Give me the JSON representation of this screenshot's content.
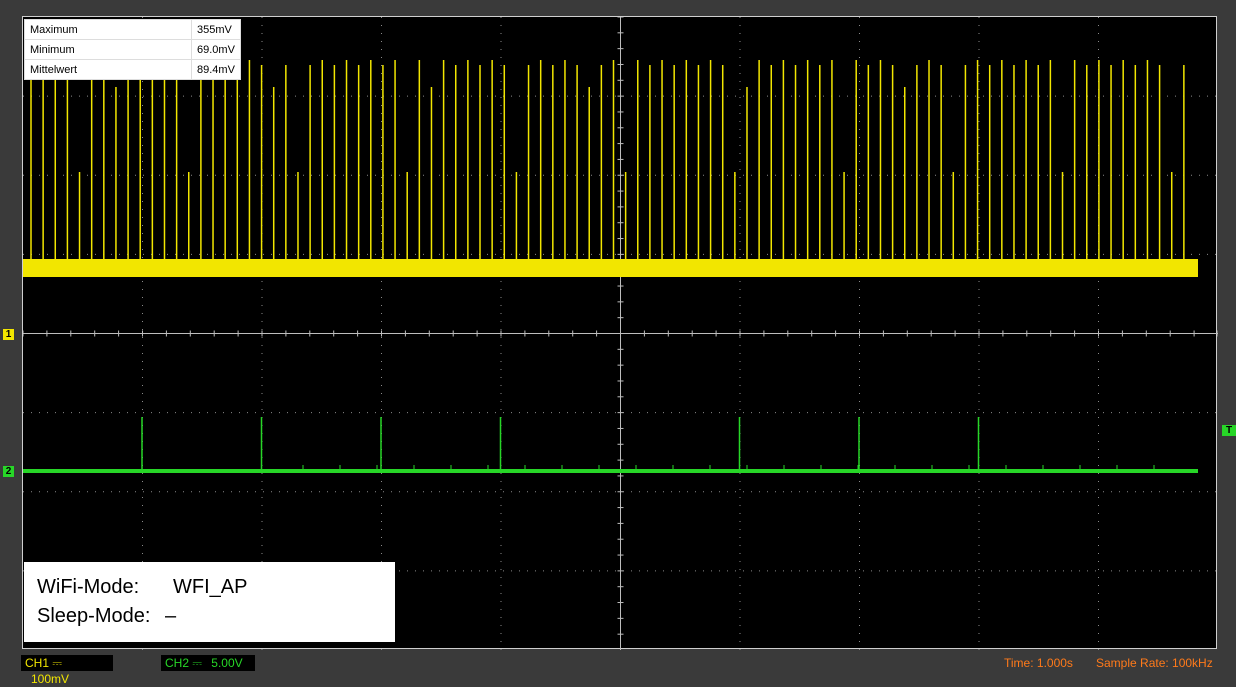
{
  "measurements": [
    {
      "label": "Maximum",
      "value": "355mV"
    },
    {
      "label": "Minimum",
      "value": "69.0mV"
    },
    {
      "label": "Mittelwert",
      "value": "89.4mV"
    }
  ],
  "info": {
    "wifi_label": "WiFi-Mode:",
    "wifi_value": "WFI_AP",
    "sleep_label": "Sleep-Mode:",
    "sleep_value": "–"
  },
  "markers": {
    "ch1": "1",
    "ch2": "2",
    "trigger": "T"
  },
  "status": {
    "ch1_label": "CH1",
    "ch1_coupling": "⎓",
    "ch1_scale": "100mV",
    "ch2_label": "CH2",
    "ch2_coupling": "⎓",
    "ch2_scale": "5.00V",
    "time": "Time: 1.000s",
    "sample_rate": "Sample Rate: 100kHz"
  },
  "colors": {
    "ch1": "#f2e600",
    "ch2": "#27d627",
    "status_text": "#ff7a1a",
    "grid": "#8a8a8a"
  },
  "chart_data": {
    "type": "line",
    "grid": {
      "divisions_x": 10,
      "divisions_y": 8
    },
    "series": [
      {
        "name": "CH1",
        "description_values": {
          "max_mV": 355,
          "min_mV": 69.0,
          "mean_mV": 89.4
        },
        "pulse_count": 96
      },
      {
        "name": "CH2",
        "pulse_count": 8
      }
    ]
  }
}
